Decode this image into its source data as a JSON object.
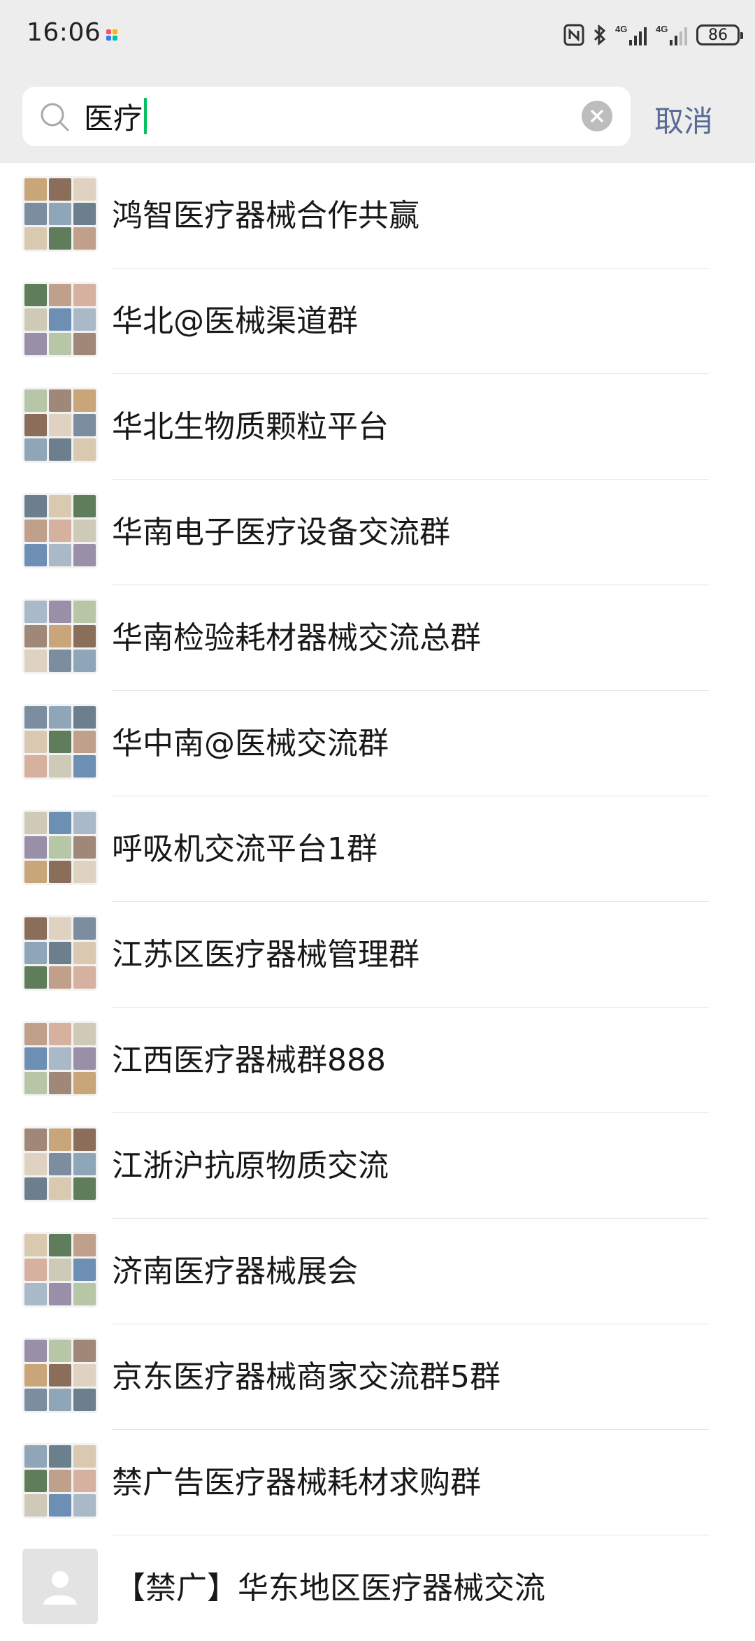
{
  "status_bar": {
    "time": "16:06",
    "network_1": "4G",
    "network_2": "4G",
    "battery": "86"
  },
  "search": {
    "value": "医疗",
    "cancel_label": "取消"
  },
  "results": [
    {
      "name": "鸿智医疗器械合作共赢",
      "avatar": "group"
    },
    {
      "name": "华北@医械渠道群",
      "avatar": "group"
    },
    {
      "name": "华北生物质颗粒平台",
      "avatar": "group"
    },
    {
      "name": "华南电子医疗设备交流群",
      "avatar": "group"
    },
    {
      "name": "华南检验耗材器械交流总群",
      "avatar": "group"
    },
    {
      "name": "华中南@医械交流群",
      "avatar": "group"
    },
    {
      "name": "呼吸机交流平台1群",
      "avatar": "group"
    },
    {
      "name": "江苏区医疗器械管理群",
      "avatar": "group"
    },
    {
      "name": "江西医疗器械群888",
      "avatar": "group"
    },
    {
      "name": "江浙沪抗原物质交流",
      "avatar": "group"
    },
    {
      "name": "济南医疗器械展会",
      "avatar": "group"
    },
    {
      "name": "京东医疗器械商家交流群5群",
      "avatar": "group"
    },
    {
      "name": "禁广告医疗器械耗材求购群",
      "avatar": "group"
    },
    {
      "name": "【禁广】华东地区医疗器械交流",
      "avatar": "default-person"
    }
  ],
  "colors": {
    "header_bg": "#ededed",
    "link": "#576b95",
    "caret": "#07c160",
    "divider": "#e5e5e5"
  }
}
